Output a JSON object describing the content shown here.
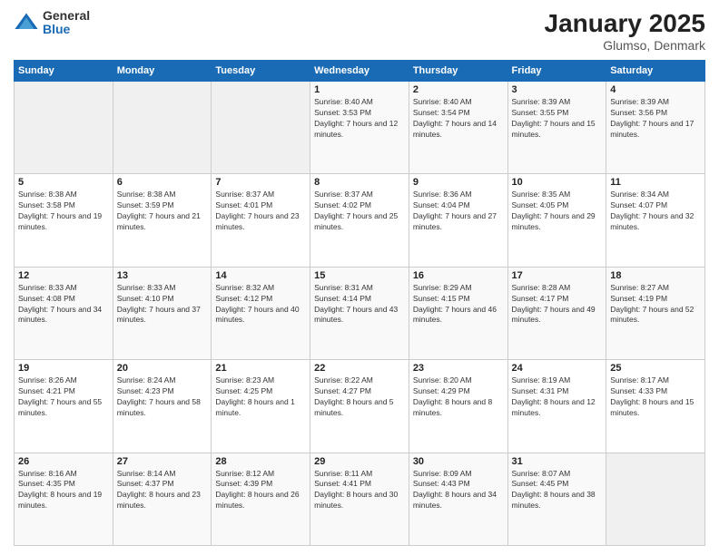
{
  "logo": {
    "general": "General",
    "blue": "Blue"
  },
  "header": {
    "title": "January 2025",
    "subtitle": "Glumso, Denmark"
  },
  "weekdays": [
    "Sunday",
    "Monday",
    "Tuesday",
    "Wednesday",
    "Thursday",
    "Friday",
    "Saturday"
  ],
  "weeks": [
    [
      {
        "day": "",
        "sunrise": "",
        "sunset": "",
        "daylight": ""
      },
      {
        "day": "",
        "sunrise": "",
        "sunset": "",
        "daylight": ""
      },
      {
        "day": "",
        "sunrise": "",
        "sunset": "",
        "daylight": ""
      },
      {
        "day": "1",
        "sunrise": "Sunrise: 8:40 AM",
        "sunset": "Sunset: 3:53 PM",
        "daylight": "Daylight: 7 hours and 12 minutes."
      },
      {
        "day": "2",
        "sunrise": "Sunrise: 8:40 AM",
        "sunset": "Sunset: 3:54 PM",
        "daylight": "Daylight: 7 hours and 14 minutes."
      },
      {
        "day": "3",
        "sunrise": "Sunrise: 8:39 AM",
        "sunset": "Sunset: 3:55 PM",
        "daylight": "Daylight: 7 hours and 15 minutes."
      },
      {
        "day": "4",
        "sunrise": "Sunrise: 8:39 AM",
        "sunset": "Sunset: 3:56 PM",
        "daylight": "Daylight: 7 hours and 17 minutes."
      }
    ],
    [
      {
        "day": "5",
        "sunrise": "Sunrise: 8:38 AM",
        "sunset": "Sunset: 3:58 PM",
        "daylight": "Daylight: 7 hours and 19 minutes."
      },
      {
        "day": "6",
        "sunrise": "Sunrise: 8:38 AM",
        "sunset": "Sunset: 3:59 PM",
        "daylight": "Daylight: 7 hours and 21 minutes."
      },
      {
        "day": "7",
        "sunrise": "Sunrise: 8:37 AM",
        "sunset": "Sunset: 4:01 PM",
        "daylight": "Daylight: 7 hours and 23 minutes."
      },
      {
        "day": "8",
        "sunrise": "Sunrise: 8:37 AM",
        "sunset": "Sunset: 4:02 PM",
        "daylight": "Daylight: 7 hours and 25 minutes."
      },
      {
        "day": "9",
        "sunrise": "Sunrise: 8:36 AM",
        "sunset": "Sunset: 4:04 PM",
        "daylight": "Daylight: 7 hours and 27 minutes."
      },
      {
        "day": "10",
        "sunrise": "Sunrise: 8:35 AM",
        "sunset": "Sunset: 4:05 PM",
        "daylight": "Daylight: 7 hours and 29 minutes."
      },
      {
        "day": "11",
        "sunrise": "Sunrise: 8:34 AM",
        "sunset": "Sunset: 4:07 PM",
        "daylight": "Daylight: 7 hours and 32 minutes."
      }
    ],
    [
      {
        "day": "12",
        "sunrise": "Sunrise: 8:33 AM",
        "sunset": "Sunset: 4:08 PM",
        "daylight": "Daylight: 7 hours and 34 minutes."
      },
      {
        "day": "13",
        "sunrise": "Sunrise: 8:33 AM",
        "sunset": "Sunset: 4:10 PM",
        "daylight": "Daylight: 7 hours and 37 minutes."
      },
      {
        "day": "14",
        "sunrise": "Sunrise: 8:32 AM",
        "sunset": "Sunset: 4:12 PM",
        "daylight": "Daylight: 7 hours and 40 minutes."
      },
      {
        "day": "15",
        "sunrise": "Sunrise: 8:31 AM",
        "sunset": "Sunset: 4:14 PM",
        "daylight": "Daylight: 7 hours and 43 minutes."
      },
      {
        "day": "16",
        "sunrise": "Sunrise: 8:29 AM",
        "sunset": "Sunset: 4:15 PM",
        "daylight": "Daylight: 7 hours and 46 minutes."
      },
      {
        "day": "17",
        "sunrise": "Sunrise: 8:28 AM",
        "sunset": "Sunset: 4:17 PM",
        "daylight": "Daylight: 7 hours and 49 minutes."
      },
      {
        "day": "18",
        "sunrise": "Sunrise: 8:27 AM",
        "sunset": "Sunset: 4:19 PM",
        "daylight": "Daylight: 7 hours and 52 minutes."
      }
    ],
    [
      {
        "day": "19",
        "sunrise": "Sunrise: 8:26 AM",
        "sunset": "Sunset: 4:21 PM",
        "daylight": "Daylight: 7 hours and 55 minutes."
      },
      {
        "day": "20",
        "sunrise": "Sunrise: 8:24 AM",
        "sunset": "Sunset: 4:23 PM",
        "daylight": "Daylight: 7 hours and 58 minutes."
      },
      {
        "day": "21",
        "sunrise": "Sunrise: 8:23 AM",
        "sunset": "Sunset: 4:25 PM",
        "daylight": "Daylight: 8 hours and 1 minute."
      },
      {
        "day": "22",
        "sunrise": "Sunrise: 8:22 AM",
        "sunset": "Sunset: 4:27 PM",
        "daylight": "Daylight: 8 hours and 5 minutes."
      },
      {
        "day": "23",
        "sunrise": "Sunrise: 8:20 AM",
        "sunset": "Sunset: 4:29 PM",
        "daylight": "Daylight: 8 hours and 8 minutes."
      },
      {
        "day": "24",
        "sunrise": "Sunrise: 8:19 AM",
        "sunset": "Sunset: 4:31 PM",
        "daylight": "Daylight: 8 hours and 12 minutes."
      },
      {
        "day": "25",
        "sunrise": "Sunrise: 8:17 AM",
        "sunset": "Sunset: 4:33 PM",
        "daylight": "Daylight: 8 hours and 15 minutes."
      }
    ],
    [
      {
        "day": "26",
        "sunrise": "Sunrise: 8:16 AM",
        "sunset": "Sunset: 4:35 PM",
        "daylight": "Daylight: 8 hours and 19 minutes."
      },
      {
        "day": "27",
        "sunrise": "Sunrise: 8:14 AM",
        "sunset": "Sunset: 4:37 PM",
        "daylight": "Daylight: 8 hours and 23 minutes."
      },
      {
        "day": "28",
        "sunrise": "Sunrise: 8:12 AM",
        "sunset": "Sunset: 4:39 PM",
        "daylight": "Daylight: 8 hours and 26 minutes."
      },
      {
        "day": "29",
        "sunrise": "Sunrise: 8:11 AM",
        "sunset": "Sunset: 4:41 PM",
        "daylight": "Daylight: 8 hours and 30 minutes."
      },
      {
        "day": "30",
        "sunrise": "Sunrise: 8:09 AM",
        "sunset": "Sunset: 4:43 PM",
        "daylight": "Daylight: 8 hours and 34 minutes."
      },
      {
        "day": "31",
        "sunrise": "Sunrise: 8:07 AM",
        "sunset": "Sunset: 4:45 PM",
        "daylight": "Daylight: 8 hours and 38 minutes."
      },
      {
        "day": "",
        "sunrise": "",
        "sunset": "",
        "daylight": ""
      }
    ]
  ]
}
